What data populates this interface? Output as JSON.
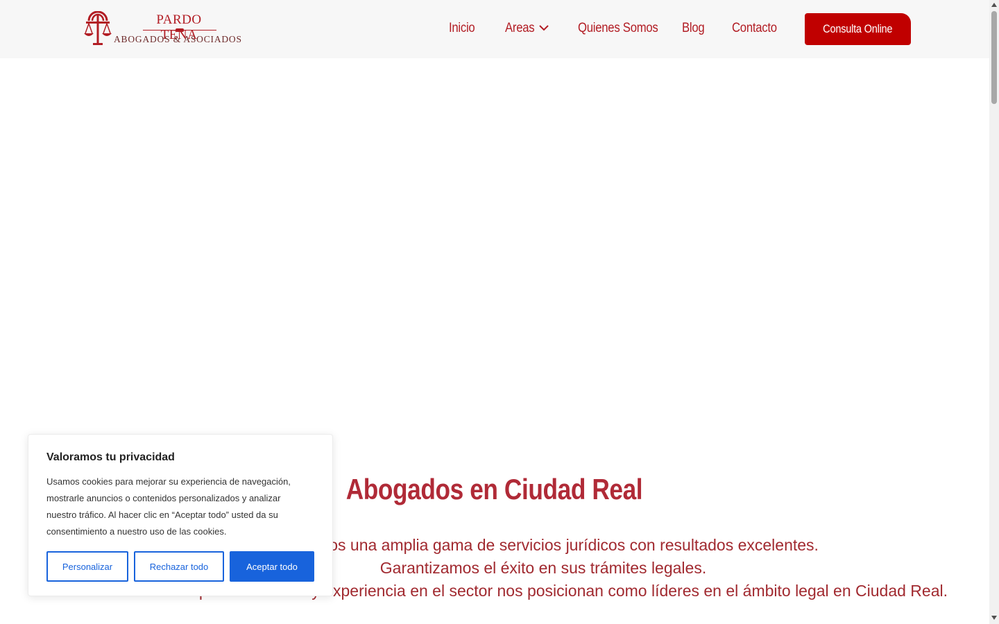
{
  "brand": {
    "name": "PARDO TENA",
    "tagline": "ABOGADOS & ASOCIADOS",
    "color": "#b21d24"
  },
  "nav": {
    "items": [
      {
        "label": "Inicio"
      },
      {
        "label": "Areas",
        "has_dropdown": true
      },
      {
        "label": "Quienes Somos"
      },
      {
        "label": "Blog"
      },
      {
        "label": "Contacto"
      }
    ],
    "cta_label": "Consulta Online"
  },
  "hero": {
    "title": "Abogados en Ciudad Real",
    "lines": [
      "Ofrecemos una amplia gama de servicios jurídicos con resultados excelentes.",
      "Garantizamos el éxito en sus trámites legales.",
      "Nuestra profesionalidad y experiencia en el sector nos posicionan como líderes en el ámbito legal en Ciudad Real."
    ]
  },
  "cookie_banner": {
    "title": "Valoramos tu privacidad",
    "text": "Usamos cookies para mejorar su experiencia de navegación, mostrarle anuncios o contenidos personalizados y analizar nuestro tráfico. Al hacer clic en “Aceptar todo” usted da su consentimiento a nuestro uso de las cookies.",
    "customize_label": "Personalizar",
    "reject_label": "Rechazar todo",
    "accept_label": "Aceptar todo",
    "accent_color": "#1863dc"
  },
  "icons": {
    "logo": "scales-of-justice-icon",
    "dropdown": "chevron-down-icon"
  }
}
